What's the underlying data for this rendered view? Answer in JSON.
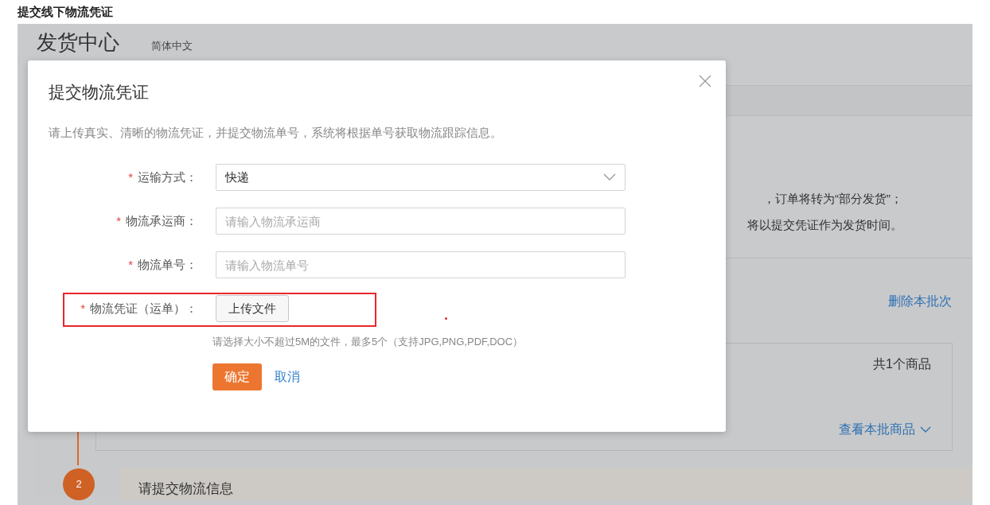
{
  "page_title": "提交线下物流凭证",
  "background": {
    "header_title": "发货中心",
    "language": "简体中文",
    "notice_lines": [
      "，订单将转为“部分发货”；",
      "将以提交凭证作为发货时间。"
    ],
    "delete_link": "删除本批次",
    "item_count": "共1个商品",
    "view_link": "查看本批商品",
    "step": {
      "number": "2",
      "title": "请提交物流信息"
    }
  },
  "dialog": {
    "title": "提交物流凭证",
    "description": "请上传真实、清晰的物流凭证，并提交物流单号，系统将根据单号获取物流跟踪信息。",
    "fields": [
      {
        "kind": "select",
        "required_mark": "*",
        "label": "运输方式：",
        "value": "快递",
        "highlighted": false
      },
      {
        "kind": "input",
        "required_mark": "*",
        "label": "物流承运商：",
        "placeholder": "请输入物流承运商",
        "highlighted": false
      },
      {
        "kind": "input",
        "required_mark": "*",
        "label": "物流单号：",
        "placeholder": "请输入物流单号",
        "highlighted": false
      },
      {
        "kind": "upload",
        "required_mark": "*",
        "label": "物流凭证（运单）：",
        "button": "上传文件",
        "highlighted": true
      }
    ],
    "upload_hint": "请选择大小不超过5M的文件，最多5个（支持JPG,PNG,PDF,DOC）",
    "confirm": "确定",
    "cancel": "取消"
  }
}
